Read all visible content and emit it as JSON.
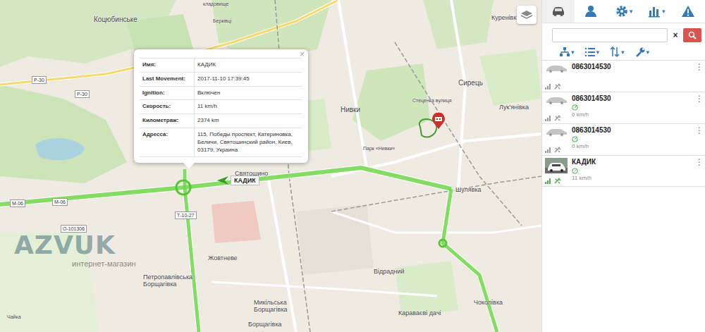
{
  "map": {
    "labels": [
      "кладовище",
      "Коцюбинське",
      "Берківці",
      "Куренівка",
      "Р-30",
      "Р-30",
      "Нивки",
      "Сирець",
      "Лук'янівка",
      "Стеценка вулиця",
      "Парк «Нивки»",
      "Святошино",
      "М-06",
      "М-06",
      "Шулявка",
      "Т-10-27",
      "О-101306",
      "Жовтневе",
      "Петропавлівська Борщагівка",
      "Відрадний",
      "Микільська Борщагівка",
      "Караваєві дачі",
      "Чоколівка",
      "Борщагівка",
      "Чайка"
    ],
    "marker": {
      "label": "КАДИК"
    },
    "watermark": {
      "brand": "AZVUK",
      "subtitle": "интернет-магазин"
    }
  },
  "popup": {
    "close": "×",
    "rows": [
      {
        "label": "Имя:",
        "value": "КАДИК"
      },
      {
        "label": "Last Movement:",
        "value": "2017-11-10 17:39:45"
      },
      {
        "label": "Ignition:",
        "value": "Включен"
      },
      {
        "label": "Скорость:",
        "value": "11 km/h"
      },
      {
        "label": "Километраж:",
        "value": "2374 km"
      },
      {
        "label": "Адресса:",
        "value": "115, Победы проспект, Катериновка, Беличи, Святошинский район, Киев, 03179, Украина"
      }
    ]
  },
  "sidebar": {
    "tabs": [
      {
        "selected": true,
        "caret": ""
      },
      {
        "selected": false,
        "caret": ""
      },
      {
        "selected": false,
        "caret": "▾"
      },
      {
        "selected": false,
        "caret": "▾"
      },
      {
        "selected": false,
        "caret": ""
      }
    ],
    "search": {
      "clear": "×"
    },
    "tools": [
      {
        "caret": "▾"
      },
      {
        "caret": "▾"
      },
      {
        "caret": "▾"
      },
      {
        "caret": "▾"
      }
    ],
    "vehicles": [
      {
        "name": "0863014530",
        "speed": "",
        "online": false,
        "kind": "car",
        "menu": "⋮"
      },
      {
        "name": "0863014530",
        "speed": "0 km/h",
        "online": false,
        "kind": "car",
        "menu": "⋮"
      },
      {
        "name": "0863014530",
        "speed": "0 km/h",
        "online": false,
        "kind": "car",
        "menu": "⋮"
      },
      {
        "name": "КАДИК",
        "speed": "11 km/h",
        "online": true,
        "kind": "photo",
        "menu": "⋮"
      }
    ]
  }
}
